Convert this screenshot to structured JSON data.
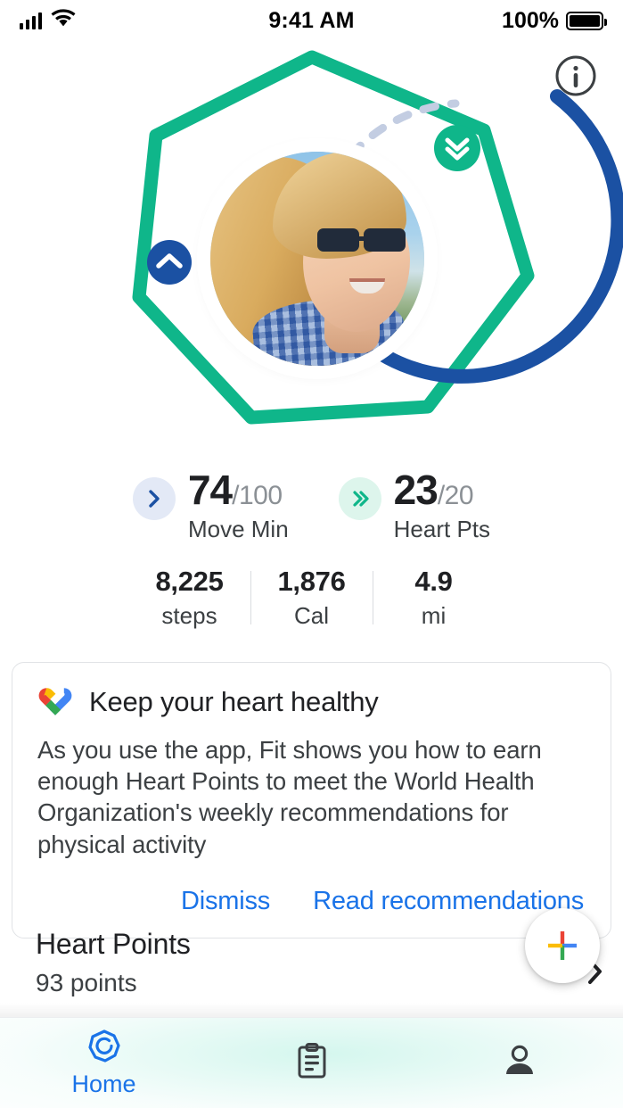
{
  "status_bar": {
    "signal_icon": "signal-bars-icon",
    "wifi_icon": "wifi-icon",
    "time": "9:41 AM",
    "battery_percent": "100%",
    "battery_icon": "battery-full-icon"
  },
  "header": {
    "info_icon": "info-icon"
  },
  "rings": {
    "move_ring_color": "#1b51a3",
    "heart_ring_color": "#0fb68a",
    "track_color": "#c3cde2",
    "move_marker_icon": "chevron-up-icon",
    "heart_marker_icon": "double-chevron-down-icon",
    "avatar_alt": "profile-photo"
  },
  "primary_stats": [
    {
      "icon": "chevron-right-icon",
      "value": "74",
      "goal": "/100",
      "label": "Move Min",
      "badge_color": "#e3e9f6",
      "icon_color": "#1b51a3"
    },
    {
      "icon": "double-chevron-right-icon",
      "value": "23",
      "goal": "/20",
      "label": "Heart Pts",
      "badge_color": "#ddf5ec",
      "icon_color": "#0fb68a"
    }
  ],
  "secondary_stats": [
    {
      "value": "8,225",
      "label": "steps"
    },
    {
      "value": "1,876",
      "label": "Cal"
    },
    {
      "value": "4.9",
      "label": "mi"
    }
  ],
  "card": {
    "logo_icon": "google-fit-heart-icon",
    "title": "Keep your heart healthy",
    "body": "As you use the app, Fit shows you how to earn enough Heart Points to meet the World Health Organization's weekly recommendations for physical activity",
    "dismiss_label": "Dismiss",
    "read_label": "Read recommendations",
    "link_color": "#1a73e8"
  },
  "heart_points_row": {
    "title": "Heart Points",
    "subtitle": "93 points",
    "chevron_icon": "chevron-right-icon"
  },
  "fab": {
    "icon": "google-plus-add-icon"
  },
  "bottom_nav": {
    "items": [
      {
        "icon": "fit-home-icon",
        "label": "Home",
        "active": true
      },
      {
        "icon": "journal-clipboard-icon",
        "label": "",
        "active": false
      },
      {
        "icon": "person-profile-icon",
        "label": "",
        "active": false
      }
    ]
  }
}
